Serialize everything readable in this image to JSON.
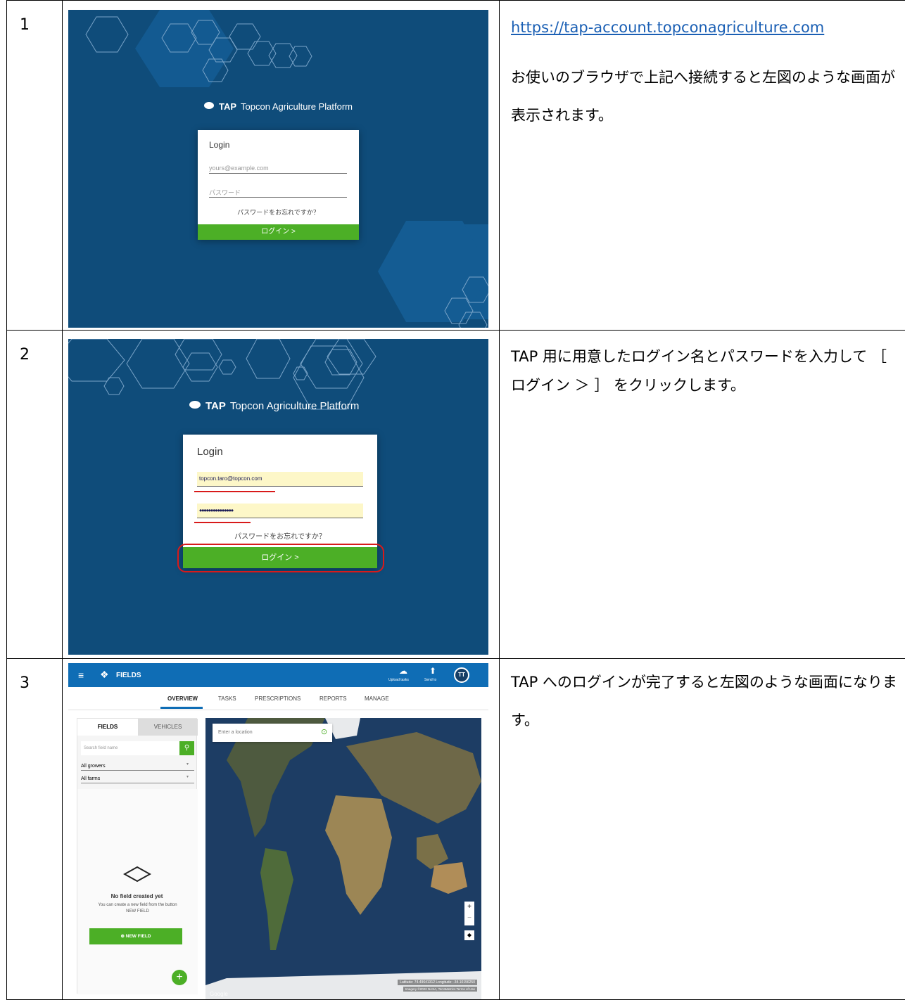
{
  "rows": [
    {
      "num": "1",
      "link": "https://tap-account.topconagriculture.com",
      "desc": "お使いのブラウザで上記へ接続すると左図のような画面が表示されます。",
      "shot": {
        "brand_tap": "TAP",
        "brand_name": "Topcon Agriculture Platform",
        "login_title": "Login",
        "email_placeholder": "yours@example.com",
        "password_placeholder": "パスワード",
        "forgot": "パスワードをお忘れですか？",
        "login_button": "ログイン >"
      }
    },
    {
      "num": "2",
      "desc": "TAP 用に用意したログイン名とパスワードを入力して ［ ログイン ＞ ］ をクリックします。",
      "shot": {
        "brand_tap": "TAP",
        "brand_name": "Topcon Agriculture Platform",
        "login_title": "Login",
        "email_value": "topcon.taro@topcon.com",
        "password_value": "•••••••••••••••",
        "forgot": "パスワードをお忘れですか？",
        "login_button": "ログイン >"
      }
    },
    {
      "num": "3",
      "desc": "TAP へのログインが完了すると左図のような画面になります。",
      "shot": {
        "app_title": "FIELDS",
        "upload_label": "Upload tasks",
        "send_label": "Send to",
        "avatar": "TT",
        "tabs": [
          "OVERVIEW",
          "TASKS",
          "PRESCRIPTIONS",
          "REPORTS",
          "MANAGE"
        ],
        "side_tabs": [
          "FIELDS",
          "VEHICLES"
        ],
        "search_placeholder": "Search field name",
        "growers": "All growers",
        "farms": "All farms",
        "empty_title": "No field created yet",
        "empty_text": "You can create a new field from the button NEW FIELD",
        "new_field": "NEW FIELD",
        "location_placeholder": "Enter a location",
        "coords": "Latitude: 74.49641312  Longitude: -34.10156250",
        "attribution": "Imagery ©2022 NASA, TerraMetrics   Terms of Use",
        "google": "Google"
      }
    }
  ]
}
